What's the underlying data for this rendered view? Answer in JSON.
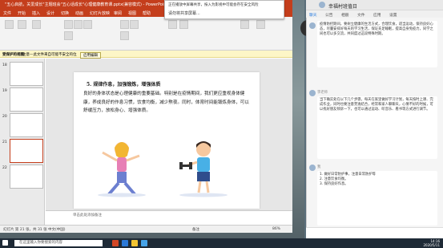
{
  "ppt": {
    "title": "\"五心启航，关爱成长\"主题班会\"五心话成长\"心理健康教育课.pptx(兼容模式) - PowerPoint",
    "tabs": [
      "文件",
      "开始",
      "插入",
      "设计",
      "切换",
      "动画",
      "幻灯片放映",
      "审阅",
      "视图",
      "帮助",
      "PDF工具集",
      "告诉我"
    ],
    "warning_label": "受保护的视图",
    "warning_text": "注意—此文件来自可能不安全的位置。除非需要编辑，否则保持在受保护的视图中比较安全。",
    "warning_button": "启用编辑",
    "thumb_numbers": [
      "18",
      "19",
      "20",
      "21",
      "22"
    ],
    "slide": {
      "heading": "5. 规律作息，加强锻炼，增强体质",
      "body": "良好的身体状态是心理健康的重要基础。特别是在疫情期间，我们更应重视身体健康，养成良好的作息习惯，饮食均衡，减少熬夜。同时，体育时间能锻炼身体，可以舒缓压力，放松身心、增强体质。"
    },
    "notes_placeholder": "单击此处添加备注",
    "status": {
      "slide_info": "幻灯片 第 21 张，共 31 张",
      "language": "中文(中国)",
      "notes": "备注",
      "zoom": "86%"
    }
  },
  "audio_bar": {
    "line1": "正在播放中屏幕共享，按入为影视中可能会存在安全风险",
    "line2": "请勿将共享屏幕..."
  },
  "chat": {
    "title": "幸福村班值日",
    "tabs": [
      "聊天",
      "公告",
      "相册",
      "文件",
      "应用",
      "设置"
    ],
    "messages": [
      {
        "name": "",
        "text": "疫情防控期间，要树立健康的生活方式，合理饮食，适当运动，保持良好心态，尽量安排好每天的学习生活，保证充足睡眠，提高自身免疫力，同学之间也可以多交流，共同度过这段特殊时期。"
      },
      {
        "name": "李老师",
        "text": "当下确实处在以下几个步骤，每天在家里做好学习计划，每天按时上课、完成作业，同时也要注意劳逸结合，经常和家人聊聊天，心情不好的时候，可以找好朋友倾诉一下，也可以通过运动、听音乐、看书等方式进行调节。"
      },
      {
        "name": "我",
        "text": "1. 做好日常防护事，注意日常防护等\n2. 注意饮食均衡。\n3. 保持良好作息。"
      }
    ]
  },
  "taskbar": {
    "search_placeholder": "在这里输入你要搜索的内容",
    "time": "14:16",
    "date": "2020/5/11"
  }
}
